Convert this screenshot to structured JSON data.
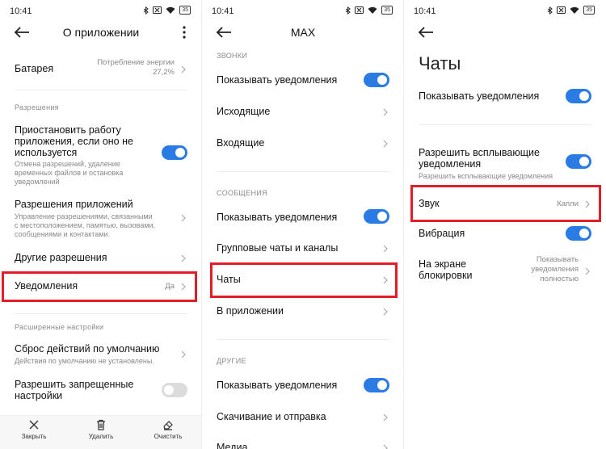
{
  "status": {
    "time": "10:41",
    "battery": "35"
  },
  "screen1": {
    "title": "О приложении",
    "battery_row": {
      "title": "Батарея",
      "value_line1": "Потребление энергии",
      "value_line2": "27,2%"
    },
    "section_permissions": "Разрешения",
    "pause_app": {
      "title_line1": "Приостановить работу",
      "title_line2": "приложения, если оно не",
      "title_line3": "используется",
      "sub_line1": "Отмена разрешений, удаление",
      "sub_line2": "временных файлов и остановка",
      "sub_line3": "уведомлений"
    },
    "app_permissions": {
      "title": "Разрешения приложений",
      "sub_line1": "Управление разрешениями, связанными",
      "sub_line2": "с местоположением, памятью, вызовами,",
      "sub_line3": "сообщениями и контактами."
    },
    "other_permissions": {
      "title": "Другие разрешения"
    },
    "notifications": {
      "title": "Уведомления",
      "value": "Да"
    },
    "section_advanced": "Расширенные настройки",
    "reset_defaults": {
      "title": "Сброс действий по умолчанию",
      "sub": "Действия по умолчанию не установлены."
    },
    "allow_restricted": {
      "title_line1": "Разрешить запрещенные",
      "title_line2": "настройки"
    },
    "bottom": {
      "close": "Закрыть",
      "delete": "Удалить",
      "clear": "Очистить"
    }
  },
  "screen2": {
    "title": "MAX",
    "section_calls": "ЗВОНКИ",
    "calls_show_notifications": "Показывать уведомления",
    "outgoing": "Исходящие",
    "incoming": "Входящие",
    "section_messages": "СООБЩЕНИЯ",
    "messages_show_notifications": "Показывать уведомления",
    "group_chats": "Групповые чаты и каналы",
    "chats": "Чаты",
    "in_app": "В приложении",
    "section_other": "ДРУГИЕ",
    "other_show_notifications": "Показывать уведомления",
    "download_send": "Скачивание и отправка",
    "media": "Медиа"
  },
  "screen3": {
    "title": "Чаты",
    "show_notifications": "Показывать уведомления",
    "popup": {
      "title_line1": "Разрешить всплывающие",
      "title_line2": "уведомления",
      "sub": "Разрешить всплывающие уведомления"
    },
    "sound": {
      "title": "Звук",
      "value": "Капли"
    },
    "vibration": "Вибрация",
    "lockscreen": {
      "title_line1": "На экране",
      "title_line2": "блокировки",
      "value_line1": "Показывать",
      "value_line2": "уведомления",
      "value_line3": "полностью"
    }
  },
  "toggles": {
    "pause_app": "on",
    "allow_restricted": "off",
    "calls_notifications": "on",
    "messages_notifications": "on",
    "other_notifications": "on",
    "chats_notifications": "on",
    "popup": "on",
    "vibration": "on"
  },
  "colors": {
    "accent": "#2a7be4",
    "highlight": "#e21e2a"
  }
}
